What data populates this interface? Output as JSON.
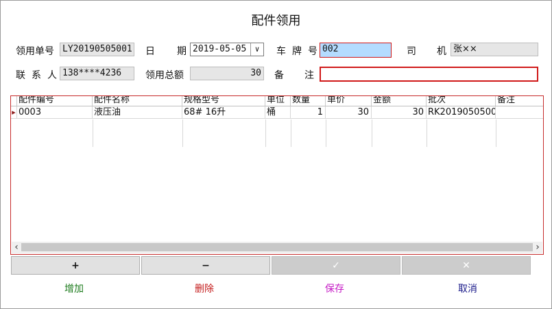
{
  "title": "配件领用",
  "form": {
    "order_no_label": "领用单号",
    "order_no": "LY20190505001",
    "date_label_1": "日",
    "date_label_2": "期",
    "date": "2019-05-05",
    "plate_label_1": "车",
    "plate_label_2": "牌",
    "plate_label_3": "号",
    "plate": "002",
    "driver_label_1": "司",
    "driver_label_2": "机",
    "driver": "张××",
    "contact_label_1": "联",
    "contact_label_2": "系",
    "contact_label_3": "人",
    "contact": "138****4236",
    "total_label": "领用总额",
    "total": "30",
    "remark_label_1": "备",
    "remark_label_2": "注",
    "remark": ""
  },
  "grid": {
    "columns": [
      "配件编号",
      "配件名称",
      "规格型号",
      "单位",
      "数量",
      "单价",
      "金额",
      "批次",
      "备注"
    ],
    "rows": [
      {
        "code": "0003",
        "name": "液压油",
        "spec": "68# 16升",
        "unit": "桶",
        "qty": "1",
        "price": "30",
        "amount": "30",
        "batch": "RK2019050500",
        "remark": ""
      }
    ],
    "row_indicator": "▸",
    "scroll_left": "‹",
    "scroll_right": "›"
  },
  "buttons": {
    "add_icon": "+",
    "delete_icon": "−",
    "save_icon": "✓",
    "cancel_icon": "✕",
    "add_label": "增加",
    "delete_label": "删除",
    "save_label": "保存",
    "cancel_label": "取消"
  },
  "colors": {
    "add": "#1a7a1a",
    "delete": "#c41c1c",
    "save": "#c418c4",
    "cancel": "#1a1a8a",
    "highlight": "#b4dcff",
    "error_border": "#d01818"
  },
  "icons": {
    "dropdown": "chevron-down-icon",
    "row_indicator": "caret-right-icon"
  }
}
